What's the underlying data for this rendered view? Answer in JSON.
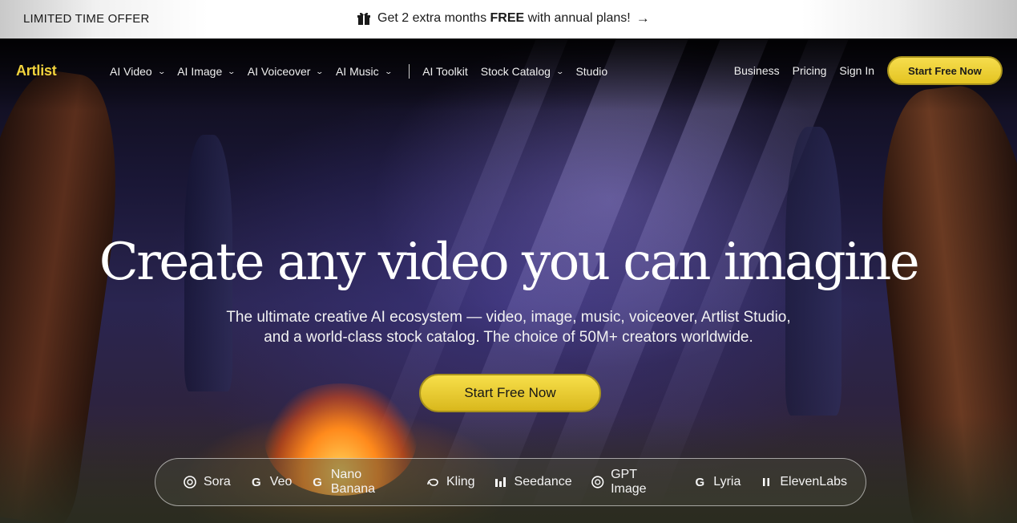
{
  "promo": {
    "left_label": "LIMITED TIME OFFER",
    "text_before": "Get 2 extra months ",
    "text_bold": "FREE",
    "text_after": " with annual plans!",
    "arrow": "→",
    "gift_icon": "gift-icon"
  },
  "nav": {
    "logo": "Artlist",
    "items": [
      {
        "label": "AI Video",
        "dropdown": true
      },
      {
        "label": "AI Image",
        "dropdown": true
      },
      {
        "label": "AI Voiceover",
        "dropdown": true
      },
      {
        "label": "AI Music",
        "dropdown": true
      },
      {
        "label": "AI Toolkit",
        "dropdown": false
      },
      {
        "label": "Stock Catalog",
        "dropdown": true
      },
      {
        "label": "Studio",
        "dropdown": false
      }
    ],
    "right": {
      "business": "Business",
      "pricing": "Pricing",
      "signin": "Sign In",
      "cta": "Start Free Now"
    }
  },
  "hero": {
    "headline": "Create any video you can imagine",
    "sub_line1": "The ultimate creative AI ecosystem — video, image, music, voiceover, Artlist Studio,",
    "sub_line2": "and a world-class stock catalog. The choice of 50M+ creators worldwide.",
    "cta": "Start Free Now"
  },
  "models": [
    {
      "label": "Sora",
      "icon": "openai-icon"
    },
    {
      "label": "Veo",
      "icon": "google-icon"
    },
    {
      "label": "Nano Banana",
      "icon": "google-icon"
    },
    {
      "label": "Kling",
      "icon": "kling-icon"
    },
    {
      "label": "Seedance",
      "icon": "bars-icon"
    },
    {
      "label": "GPT Image",
      "icon": "openai-icon"
    },
    {
      "label": "Lyria",
      "icon": "google-icon"
    },
    {
      "label": "ElevenLabs",
      "icon": "pause-bars-icon"
    }
  ],
  "colors": {
    "accent": "#f2d33c",
    "cta_bg": "#e8c92a"
  }
}
